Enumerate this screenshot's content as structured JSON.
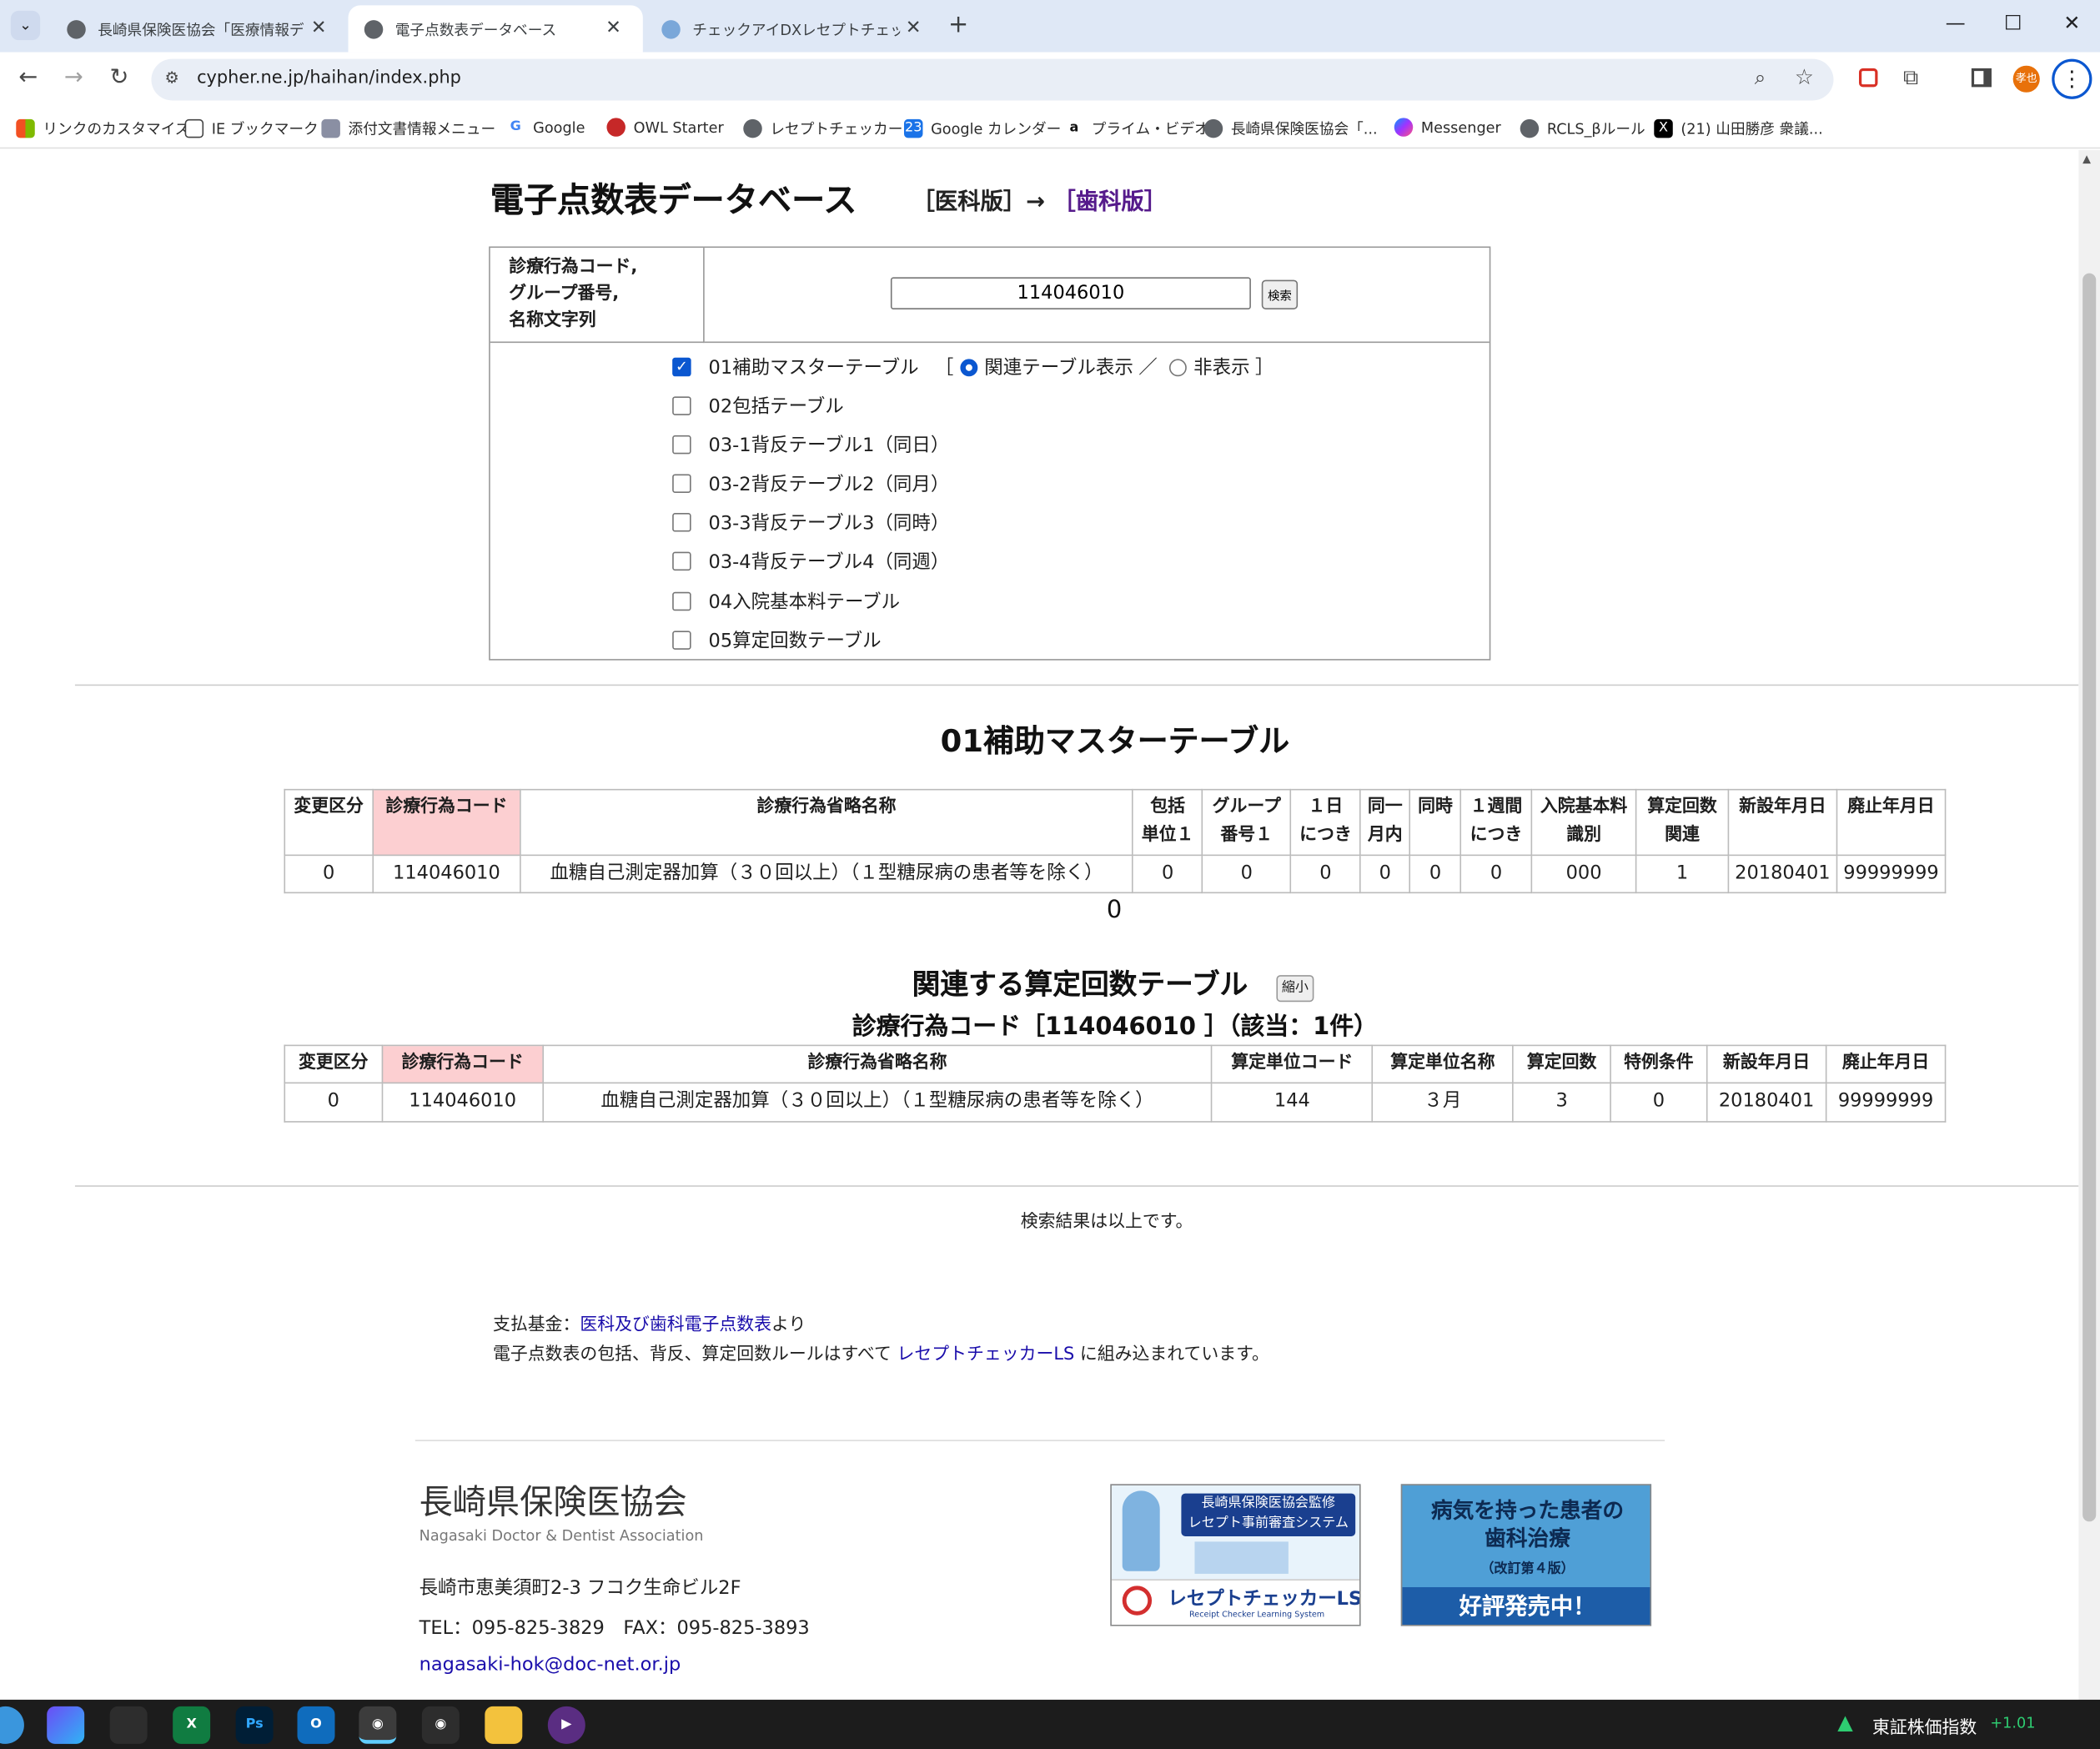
{
  "browser": {
    "tabs": [
      {
        "title": "長崎県保険医協会「医療情報デ…",
        "active": false
      },
      {
        "title": "電子点数表データベース",
        "active": true
      },
      {
        "title": "チェックアイDXレセプトチェッカー",
        "active": false
      }
    ],
    "url": "cypher.ne.jp/haihan/index.php",
    "profile_badge": "孝也",
    "bookmarks": [
      "リンクのカスタマイズ",
      "IE ブックマーク",
      "添付文書情報メニュー",
      "Google",
      "OWL Starter",
      "レセプトチェッカーLS",
      "Google カレンダー",
      "プライム・ビデオ",
      "長崎県保険医協会「...",
      "Messenger",
      "RCLS_βルール",
      "(21) 山田勝彦 衆議..."
    ]
  },
  "page": {
    "title": "電子点数表データベース",
    "edition_current": "［医科版］→",
    "edition_link": "［歯科版］",
    "search": {
      "label_lines": [
        "診療行為コード,",
        "グループ番号,",
        "名称文字列"
      ],
      "value": "114046010",
      "button": "検索"
    },
    "options": [
      {
        "label": "01補助マスターテーブル",
        "checked": true
      },
      {
        "label": "02包括テーブル",
        "checked": false
      },
      {
        "label": "03-1背反テーブル1（同日）",
        "checked": false
      },
      {
        "label": "03-2背反テーブル2（同月）",
        "checked": false
      },
      {
        "label": "03-3背反テーブル3（同時）",
        "checked": false
      },
      {
        "label": "03-4背反テーブル4（同週）",
        "checked": false
      },
      {
        "label": "04入院基本料テーブル",
        "checked": false
      },
      {
        "label": "05算定回数テーブル",
        "checked": false
      }
    ],
    "related_bracket_open": "［",
    "related_show": "関連テーブル表示",
    "related_slash": "／",
    "related_hide": "非表示",
    "related_bracket_close": "］",
    "master": {
      "heading": "01補助マスターテーブル",
      "headers": [
        [
          "変更区分"
        ],
        [
          "診療行為コード"
        ],
        [
          "診療行為省略名称"
        ],
        [
          "包括",
          "単位１"
        ],
        [
          "グループ",
          "番号１"
        ],
        [
          "１日",
          "につき"
        ],
        [
          "同一",
          "月内"
        ],
        [
          "同時"
        ],
        [
          "１週間",
          "につき"
        ],
        [
          "入院基本料",
          "識別"
        ],
        [
          "算定回数",
          "関連"
        ],
        [
          "新設年月日"
        ],
        [
          "廃止年月日"
        ]
      ],
      "row": [
        "0",
        "114046010",
        "血糖自己測定器加算（３０回以上）（１型糖尿病の患者等を除く）",
        "0",
        "0",
        "0",
        "0",
        "0",
        "0",
        "000",
        "1",
        "20180401",
        "99999999"
      ],
      "below": "0"
    },
    "related": {
      "heading": "関連する算定回数テーブル",
      "shrink_button": "縮小",
      "subheading": "診療行為コード［114046010 ］（該当：1件）",
      "headers": [
        "変更区分",
        "診療行為コード",
        "診療行為省略名称",
        "算定単位コード",
        "算定単位名称",
        "算定回数",
        "特例条件",
        "新設年月日",
        "廃止年月日"
      ],
      "row": [
        "0",
        "114046010",
        "血糖自己測定器加算（３０回以上）（１型糖尿病の患者等を除く）",
        "144",
        "３月",
        "3",
        "0",
        "20180401",
        "99999999"
      ]
    },
    "end_message": "検索結果は以上です。",
    "source_prefix": "支払基金：",
    "source_link": "医科及び歯科電子点数表",
    "source_suffix": "より",
    "note_prefix": "電子点数表の包括、背反、算定回数ルールはすべて ",
    "note_link": "レセプトチェッカーLS",
    "note_suffix": " に組み込まれています。"
  },
  "footer": {
    "org_name": "長崎県保険医協会",
    "org_name_en": "Nagasaki Doctor & Dentist Association",
    "address": "長崎市恵美須町2-3 フコク生命ビル2F",
    "tel_fax": "TEL：095-825-3829　FAX：095-825-3893",
    "email": "nagasaki-hok@doc-net.or.jp",
    "ad1": {
      "line1": "長崎県保険医協会監修",
      "line2": "レセプト事前審査システム",
      "brand": "レセプトチェッカーLS",
      "sub": "Receipt Checker Learning System"
    },
    "ad2": {
      "line1": "病気を持った患者の",
      "line2": "歯科治療",
      "line3": "（改訂第４版）",
      "cta": "好評発売中！"
    }
  },
  "taskbar": {
    "stock_label": "東証株価指数",
    "stock_change": "+1.01"
  },
  "colors": {
    "accent": "#0b57d0",
    "key_header": "#fccfd1",
    "link": "#1a0dab",
    "visited": "#551a8b"
  }
}
